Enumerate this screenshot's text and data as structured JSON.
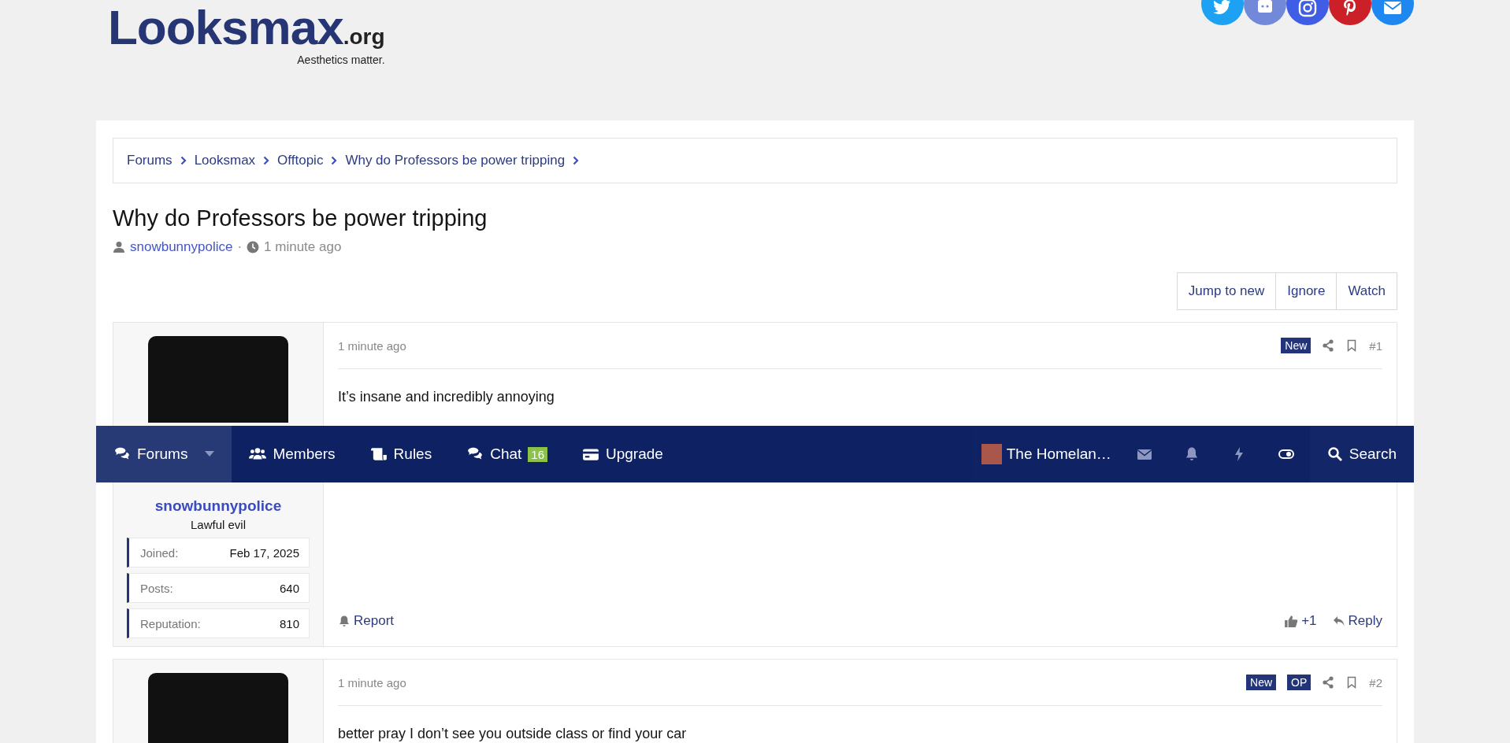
{
  "header": {
    "logo_text": "Looksmax",
    "logo_suffix": ".org",
    "tagline": "Aesthetics matter."
  },
  "breadcrumbs": [
    "Forums",
    "Looksmax",
    "Offtopic",
    "Why do Professors be power tripping"
  ],
  "thread": {
    "title": "Why do Professors be power tripping",
    "author": "snowbunnypolice",
    "separator": "·",
    "time": "1 minute ago"
  },
  "thread_actions": [
    "Jump to new",
    "Ignore",
    "Watch"
  ],
  "posts": [
    {
      "time": "1 minute ago",
      "badges": [
        "New"
      ],
      "number": "#1",
      "body": "It’s insane and incredibly annoying",
      "user": {
        "name": "snowbunnypolice",
        "title": "Lawful evil",
        "stats": [
          {
            "label": "Joined:",
            "value": "Feb 17, 2025"
          },
          {
            "label": "Posts:",
            "value": "640"
          },
          {
            "label": "Reputation:",
            "value": "810"
          }
        ]
      },
      "footer": {
        "report": "Report",
        "likes": "+1",
        "reply": "Reply"
      }
    },
    {
      "time": "1 minute ago",
      "badges": [
        "New",
        "OP"
      ],
      "number": "#2",
      "body": "better pray I don’t see you outside class or find your car"
    }
  ],
  "nav": {
    "items": [
      {
        "label": "Forums",
        "kind": "forums",
        "selected": true
      },
      {
        "label": "Members",
        "kind": "members",
        "selected": false
      },
      {
        "label": "Rules",
        "kind": "rules",
        "selected": false
      },
      {
        "label": "Chat",
        "kind": "chat",
        "selected": false,
        "badge": "16"
      },
      {
        "label": "Upgrade",
        "kind": "upgrade",
        "selected": false
      }
    ],
    "user": "The Homelan…",
    "search": "Search"
  }
}
